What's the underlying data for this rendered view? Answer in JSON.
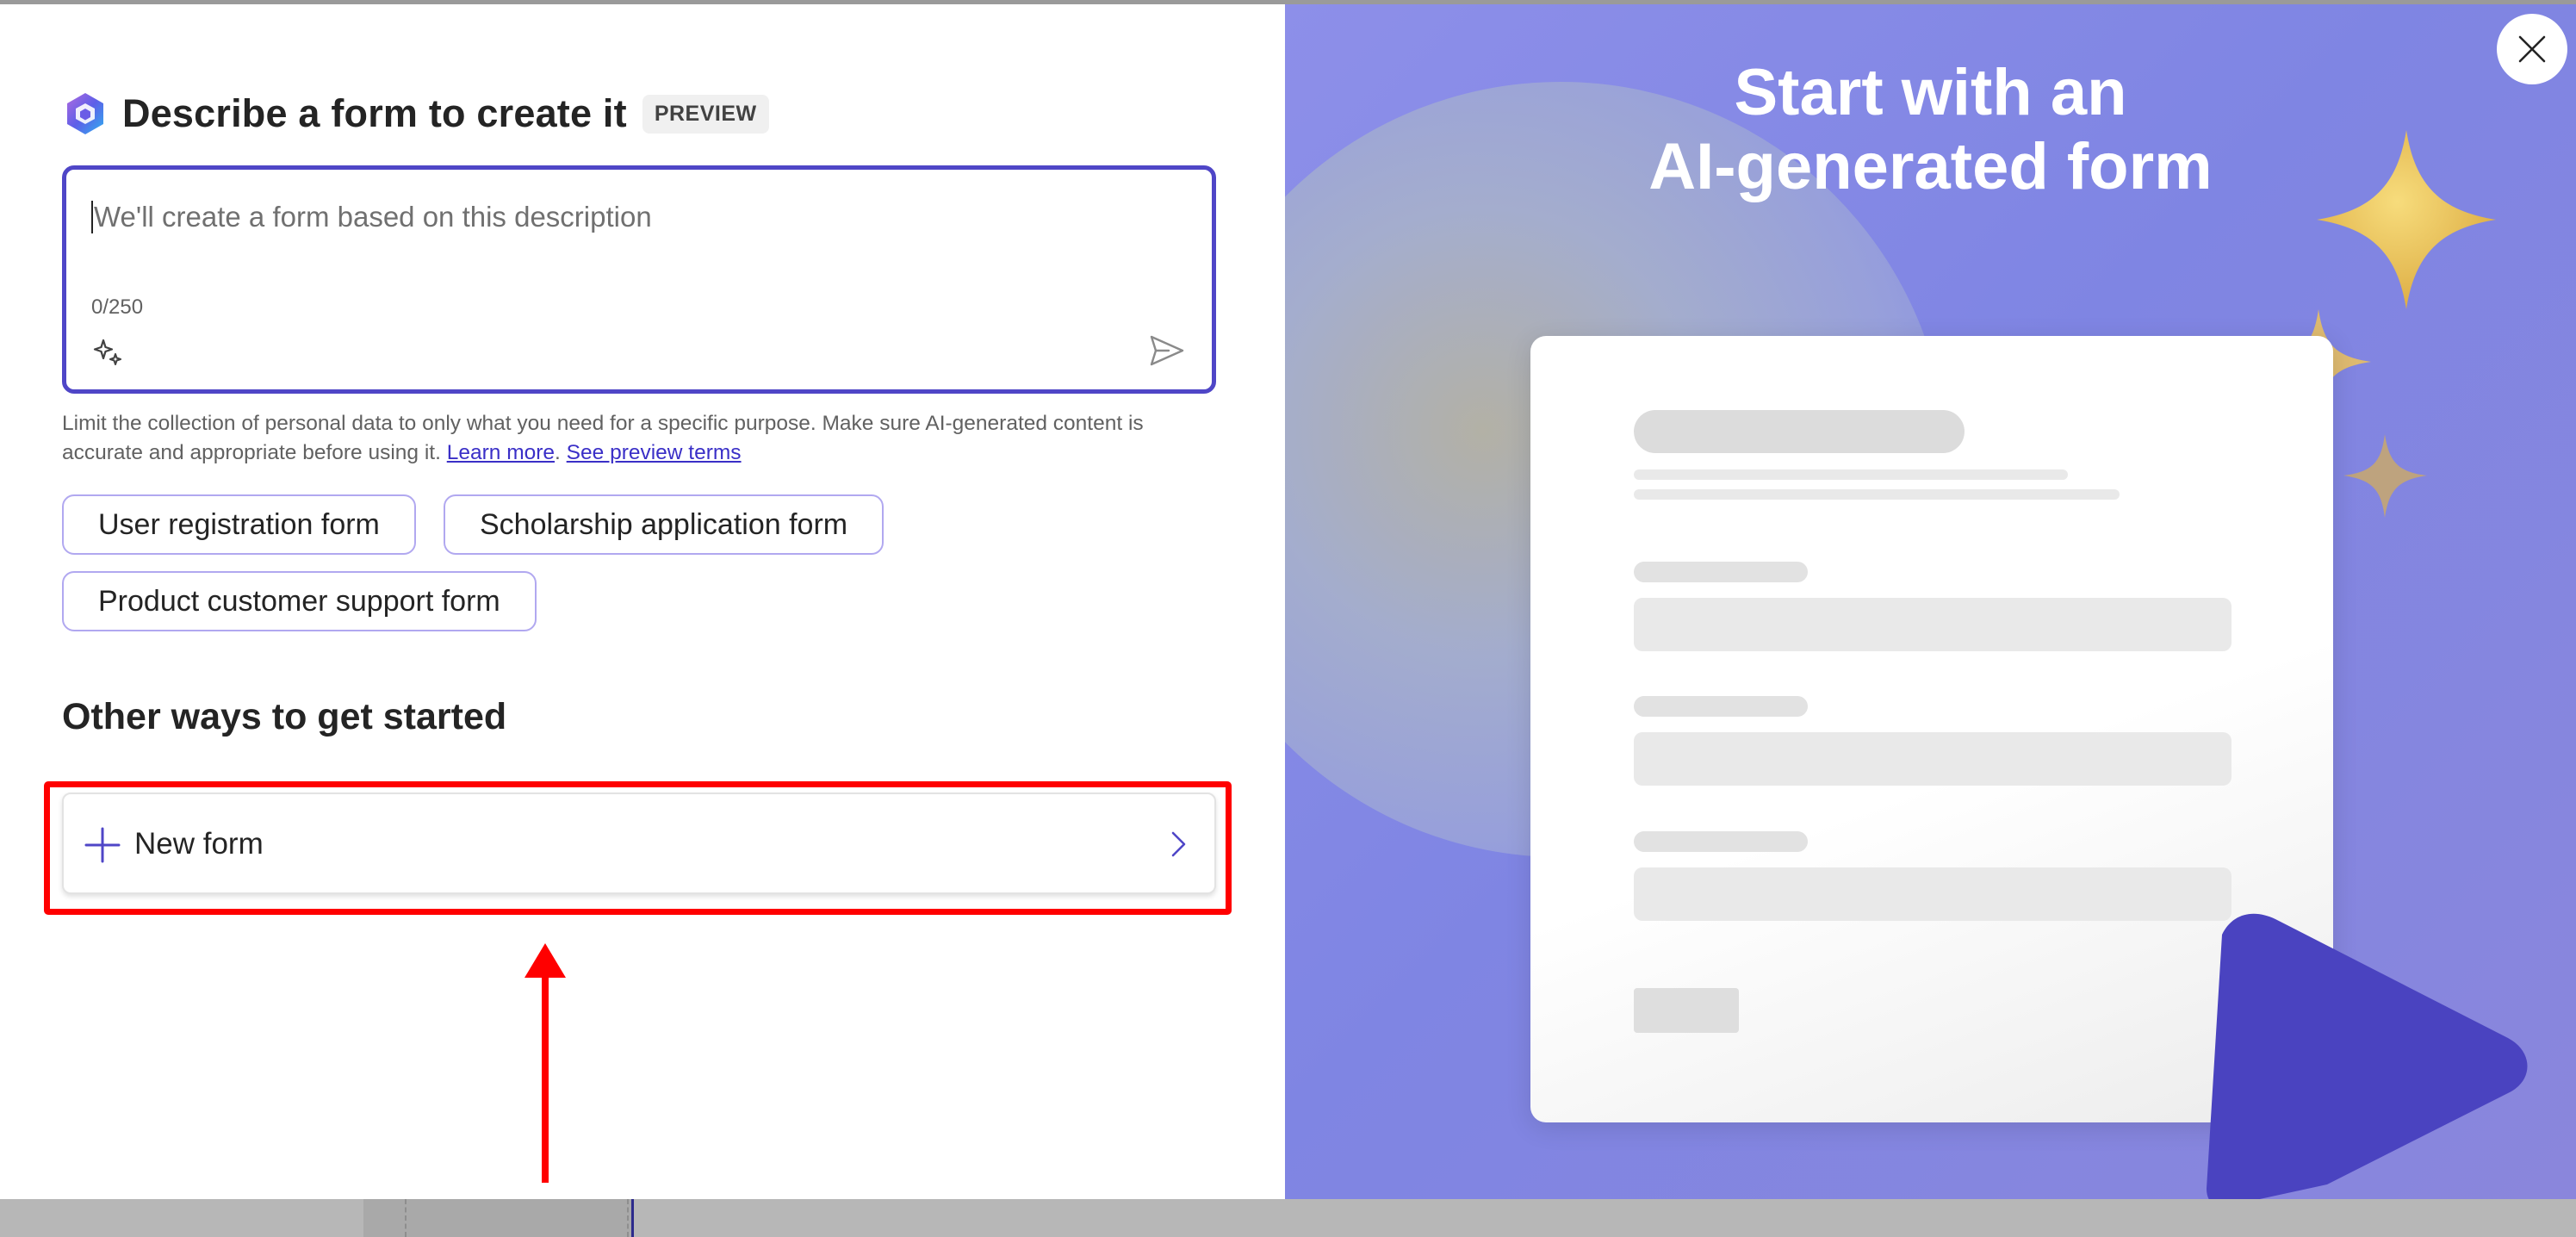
{
  "dialog": {
    "title": "Describe a form to create it",
    "badge": "PREVIEW",
    "prompt": {
      "placeholder": "We'll create a form based on this description",
      "counter": "0/250"
    },
    "disclaimer": {
      "text": "Limit the collection of personal data to only what you need for a specific purpose. Make sure AI-generated content is accurate and appropriate before using it.",
      "learn_more": "Learn more",
      "separator": ".",
      "preview_terms": "See preview terms"
    },
    "suggestions": [
      "User registration form",
      "Scholarship application form",
      "Product customer support form"
    ],
    "other_ways": {
      "title": "Other ways to get started",
      "new_form_label": "New form"
    }
  },
  "hero": {
    "line1": "Start with an",
    "line2": "AI-generated form"
  },
  "icons": {
    "logo": "forms-logo-icon",
    "sparkle": "sparkle-icon",
    "send": "send-icon",
    "plus": "plus-icon",
    "chevron": "chevron-right-icon",
    "close": "close-icon"
  },
  "colors": {
    "accent": "#4f46c7",
    "highlight": "#ff0000",
    "hero_bg": "#8388e6",
    "chip_border": "#b1a8f0"
  }
}
